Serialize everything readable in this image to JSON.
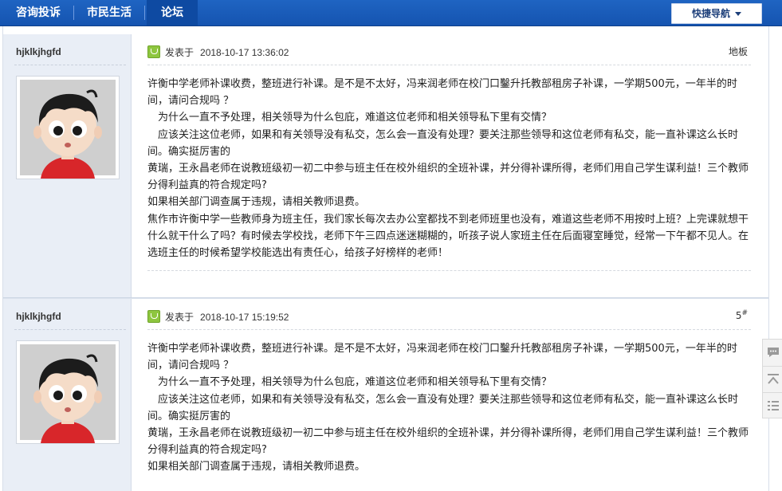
{
  "nav": {
    "items": [
      "咨询投诉",
      "市民生活",
      "论坛"
    ],
    "active": "论坛",
    "quick_nav": "快捷导航"
  },
  "posts": [
    {
      "username": "hjklkjhgfd",
      "posted_label": "发表于",
      "time": "2018-10-17 13:36:02",
      "floor": "地板",
      "floor_sup": "",
      "lines": [
        "许衡中学老师补课收费，整班进行补课。是不是不太好，冯来润老师在校门口鑿升托教部租房子补课，一学期500元，一年半的时间，请问合规吗 ？",
        "　为什么一直不予处理，相关领导为什么包庇，难道这位老师和相关领导私下里有交情？",
        "　应该关注这位老师，如果和有关领导没有私交，怎么会一直没有处理？要关注那些领导和这位老师有私交，能一直补课这么长时间。确实挺厉害的",
        "黄瑞，王永昌老师在说教班级初一初二中参与班主任在校外组织的全班补课，并分得补课所得，老师们用自己学生谋利益！三个教师分得利益真的符合规定吗?",
        "如果相关部门调查属于违规，请相关教师退费。",
        "焦作市许衡中学一些教师身为班主任，我们家长每次去办公室都找不到老师班里也没有，难道这些老师不用按时上班？上完课就想干什么就干什么了吗？有时候去学校找，老师下午三四点迷迷糊糊的，听孩子说人家班主任在后面寝室睡觉，经常一下午都不见人。在选班主任的时候希望学校能选出有责任心，给孩子好榜样的老师！"
      ]
    },
    {
      "username": "hjklkjhgfd",
      "posted_label": "发表于",
      "time": "2018-10-17 15:19:52",
      "floor": "5",
      "floor_sup": "#",
      "lines": [
        "许衡中学老师补课收费，整班进行补课。是不是不太好，冯来润老师在校门口鑿升托教部租房子补课，一学期500元，一年半的时间，请问合规吗 ？",
        "　为什么一直不予处理，相关领导为什么包庇，难道这位老师和相关领导私下里有交情？",
        "　应该关注这位老师，如果和有关领导没有私交，怎么会一直没有处理？要关注那些领导和这位老师有私交，能一直补课这么长时间。确实挺厉害的",
        "黄瑞，王永昌老师在说教班级初一初二中参与班主任在校外组织的全班补课，并分得补课所得，老师们用自己学生谋利益！三个教师分得利益真的符合规定吗?",
        "如果相关部门调查属于违规，请相关教师退费。"
      ]
    }
  ],
  "tools": [
    "comment-icon",
    "back-to-top-icon",
    "list-icon"
  ],
  "colors": {
    "nav_bg": "#1a5cba",
    "side_bg": "#e9eef6",
    "badge": "#8ec63f"
  }
}
